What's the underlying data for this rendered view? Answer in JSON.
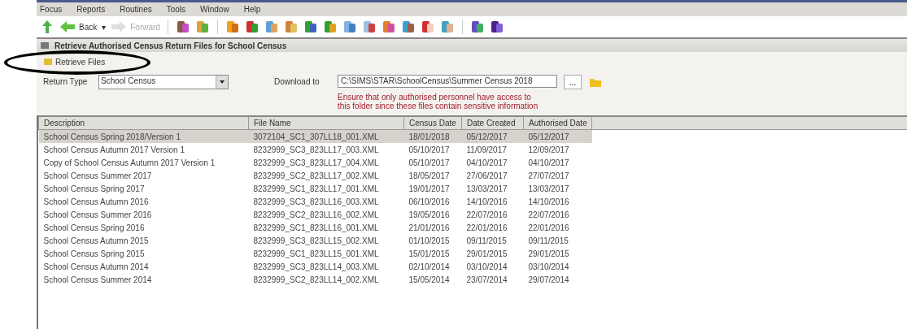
{
  "menu_bar": [
    "Focus",
    "Reports",
    "Routines",
    "Tools",
    "Window",
    "Help"
  ],
  "toolbar": {
    "back": "Back",
    "back_caret": "▾",
    "forward": "Forward"
  },
  "window": {
    "title": "Retrieve Authorised Census Return Files for School Census"
  },
  "action": {
    "label": "Retrieve Files"
  },
  "form": {
    "return_type_label": "Return Type",
    "return_type": "School Census",
    "download_label": "Download to",
    "download_path": "C:\\SIMS\\STAR\\SchoolCensus\\Summer Census 2018",
    "browse": "...",
    "warning": "Ensure that only authorised personnel have access to this folder since these files contain sensitive information"
  },
  "table": {
    "columns": [
      "Description",
      "File Name",
      "Census Date",
      "Date Created",
      "Authorised Date"
    ],
    "rows": [
      {
        "cells": [
          "School Census Spring 2018/Version 1",
          "3072104_SC1_307LL18_001.XML",
          "18/01/2018",
          "05/12/2017",
          "05/12/2017"
        ],
        "selected": true
      },
      {
        "cells": [
          "School Census Autumn 2017 Version 1",
          "8232999_SC3_823LL17_003.XML",
          "05/10/2017",
          "11/09/2017",
          "12/09/2017"
        ],
        "selected": false
      },
      {
        "cells": [
          "Copy of School Census Autumn 2017 Version 1",
          "8232999_SC3_823LL17_004.XML",
          "05/10/2017",
          "04/10/2017",
          "04/10/2017"
        ],
        "selected": false
      },
      {
        "cells": [
          "School Census Summer 2017",
          "8232999_SC2_823LL17_002.XML",
          "18/05/2017",
          "27/06/2017",
          "27/07/2017"
        ],
        "selected": false
      },
      {
        "cells": [
          "School Census Spring 2017",
          "8232999_SC1_823LL17_001.XML",
          "19/01/2017",
          "13/03/2017",
          "13/03/2017"
        ],
        "selected": false
      },
      {
        "cells": [
          "School Census Autumn 2016",
          "8232999_SC3_823LL16_003.XML",
          "06/10/2016",
          "14/10/2016",
          "14/10/2016"
        ],
        "selected": false
      },
      {
        "cells": [
          "School Census Summer 2016",
          "8232999_SC2_823LL16_002.XML",
          "19/05/2016",
          "22/07/2016",
          "22/07/2016"
        ],
        "selected": false
      },
      {
        "cells": [
          "School Census Spring 2016",
          "8232999_SC1_823LL16_001.XML",
          "21/01/2016",
          "22/01/2016",
          "22/01/2016"
        ],
        "selected": false
      },
      {
        "cells": [
          "School Census Autumn 2015",
          "8232999_SC3_823LL15_002.XML",
          "01/10/2015",
          "09/11/2015",
          "09/11/2015"
        ],
        "selected": false
      },
      {
        "cells": [
          "School Census Spring 2015",
          "8232999_SC1_823LL15_001.XML",
          "15/01/2015",
          "29/01/2015",
          "29/01/2015"
        ],
        "selected": false
      },
      {
        "cells": [
          "School Census Autumn 2014",
          "8232999_SC3_823LL14_003.XML",
          "02/10/2014",
          "03/10/2014",
          "03/10/2014"
        ],
        "selected": false
      },
      {
        "cells": [
          "School Census Summer 2014",
          "8232999_SC2_823LL14_002.XML",
          "15/05/2014",
          "23/07/2014",
          "29/07/2014"
        ],
        "selected": false
      }
    ]
  }
}
